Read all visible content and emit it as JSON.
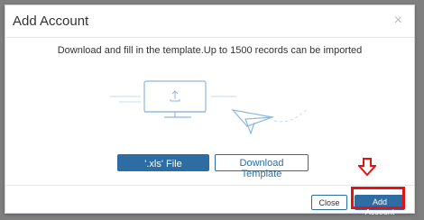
{
  "dialog": {
    "title": "Add Account",
    "close_glyph": "×",
    "instruction": "Download and fill in the template.Up to 1500 records can be imported",
    "illustration_icon": "upload-to-computer-with-paper-plane",
    "buttons": {
      "xls_file": "'.xls' File",
      "download_template": "Download Template",
      "close": "Close",
      "add_account": "Add Account"
    }
  },
  "annotation": {
    "arrow_color": "#e01414",
    "highlight_color": "#e01414"
  },
  "colors": {
    "primary": "#2d6da3",
    "overlay": "#7f7f7f",
    "illustration": "#8fb8de"
  }
}
